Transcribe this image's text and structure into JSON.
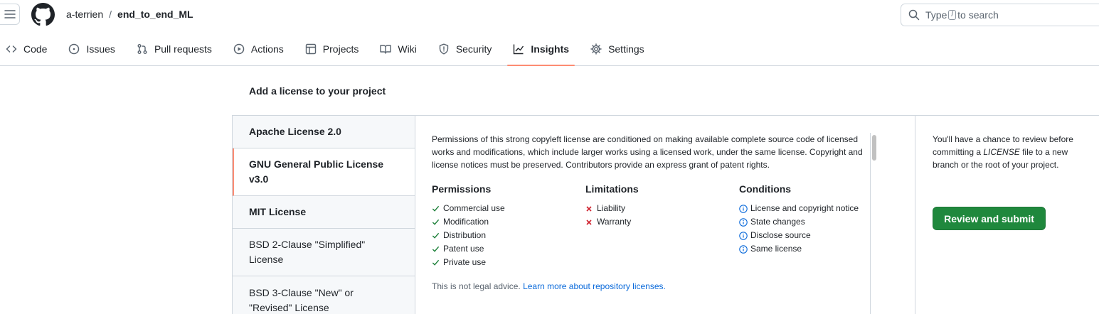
{
  "header": {
    "owner": "a-terrien",
    "separator": "/",
    "repo": "end_to_end_ML",
    "search": {
      "before": "Type",
      "key": "/",
      "after": "to search"
    }
  },
  "tabs": [
    {
      "label": "Code",
      "icon": "code-icon"
    },
    {
      "label": "Issues",
      "icon": "issue-icon"
    },
    {
      "label": "Pull requests",
      "icon": "pull-request-icon"
    },
    {
      "label": "Actions",
      "icon": "play-icon"
    },
    {
      "label": "Projects",
      "icon": "table-icon"
    },
    {
      "label": "Wiki",
      "icon": "book-icon"
    },
    {
      "label": "Security",
      "icon": "shield-icon"
    },
    {
      "label": "Insights",
      "icon": "graph-icon",
      "active": true
    },
    {
      "label": "Settings",
      "icon": "gear-icon"
    }
  ],
  "main": {
    "title": "Add a license to your project",
    "licenses": [
      {
        "label": "Apache License 2.0"
      },
      {
        "label": "GNU General Public License v3.0",
        "active": true
      },
      {
        "label": "MIT License"
      },
      {
        "label": "BSD 2-Clause \"Simplified\" License"
      },
      {
        "label": "BSD 3-Clause \"New\" or \"Revised\" License"
      }
    ],
    "description": "Permissions of this strong copyleft license are conditioned on making available complete source code of licensed works and modifications, which include larger works using a licensed work, under the same license. Copyright and license notices must be preserved. Contributors provide an express grant of patent rights.",
    "permissions": {
      "heading": "Permissions",
      "items": [
        "Commercial use",
        "Modification",
        "Distribution",
        "Patent use",
        "Private use"
      ]
    },
    "limitations": {
      "heading": "Limitations",
      "items": [
        "Liability",
        "Warranty"
      ]
    },
    "conditions": {
      "heading": "Conditions",
      "items": [
        "License and copyright notice",
        "State changes",
        "Disclose source",
        "Same license"
      ]
    },
    "disclaimer": {
      "text": "This is not legal advice.",
      "link": "Learn more about repository licenses."
    },
    "side_note": {
      "before": "You'll have a chance to review before committing a",
      "file": "LICENSE",
      "after": "file to a new branch or the root of your project."
    },
    "submit_label": "Review and submit"
  },
  "colors": {
    "accent": "#fd8c73",
    "primary_button": "#1f883d",
    "link": "#0969da",
    "check": "#1a7f37",
    "cross": "#cf222e"
  }
}
